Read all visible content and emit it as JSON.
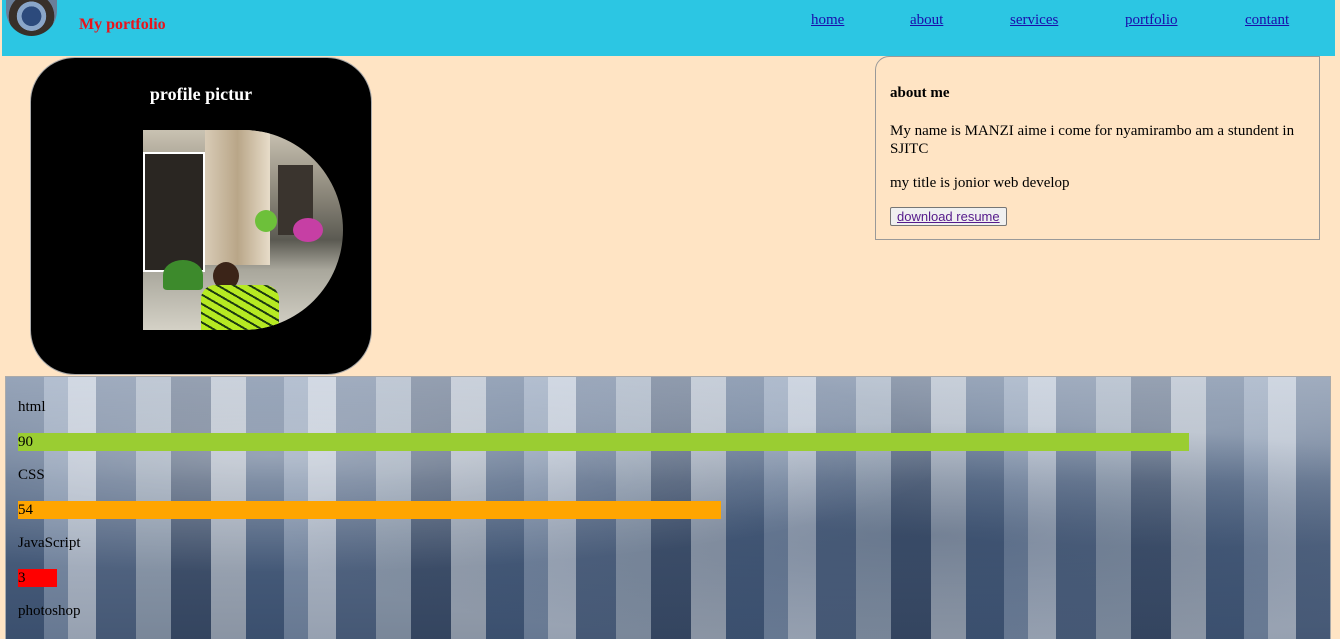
{
  "header": {
    "brand": "My portfolio",
    "nav": [
      "home",
      "about",
      "services",
      "portfolio",
      "contant"
    ],
    "color": "#2cc6e3",
    "brand_color": "#e8141c"
  },
  "profile": {
    "title": "profile pictur"
  },
  "about": {
    "heading": "about me",
    "bio": "My name is MANZI aime i come for nyamirambo am a stundent in SJITC",
    "title_line": "my title is jonior web develop",
    "button": "download resume"
  },
  "skills": [
    {
      "name": "html",
      "value": "90",
      "percent": 90,
      "color": "#9acd32"
    },
    {
      "name": "CSS",
      "value": "54",
      "percent": 54,
      "color": "#ffa500"
    },
    {
      "name": "JavaScript",
      "value": "3",
      "percent": 3,
      "color": "#ff0000"
    },
    {
      "name": "photoshop"
    }
  ]
}
